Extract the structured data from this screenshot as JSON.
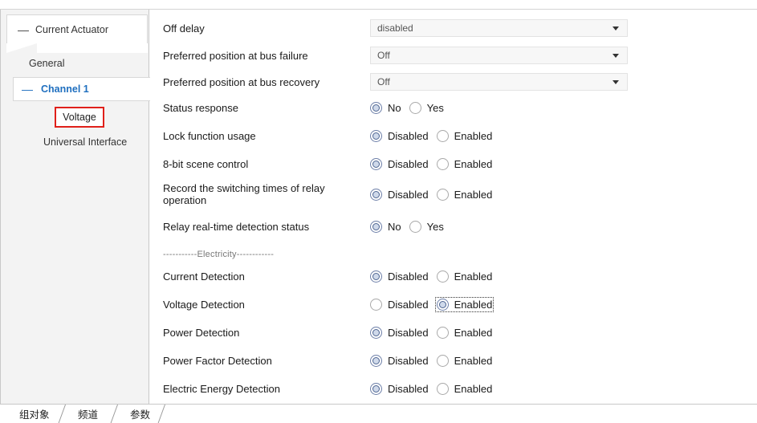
{
  "sidebar": {
    "root": "Current Actuator",
    "general": "General",
    "channel": "Channel 1",
    "voltage": "Voltage",
    "universal": "Universal Interface"
  },
  "params": {
    "off_delay": {
      "label": "Off delay",
      "value": "disabled"
    },
    "bus_failure": {
      "label": "Preferred position at bus failure",
      "value": "Off"
    },
    "bus_recovery": {
      "label": "Preferred position at bus recovery",
      "value": "Off"
    },
    "status_response": {
      "label": "Status response",
      "opt1": "No",
      "opt2": "Yes",
      "selected": "No"
    },
    "lock_function": {
      "label": "Lock function usage",
      "opt1": "Disabled",
      "opt2": "Enabled",
      "selected": "Disabled"
    },
    "scene_control": {
      "label": "8-bit scene control",
      "opt1": "Disabled",
      "opt2": "Enabled",
      "selected": "Disabled"
    },
    "record_switching": {
      "label": "Record the switching times of relay operation",
      "opt1": "Disabled",
      "opt2": "Enabled",
      "selected": "Disabled"
    },
    "relay_detection": {
      "label": "Relay real-time detection status",
      "opt1": "No",
      "opt2": "Yes",
      "selected": "No"
    },
    "separator": "-----------Electricity------------",
    "current_detection": {
      "label": "Current Detection",
      "opt1": "Disabled",
      "opt2": "Enabled",
      "selected": "Disabled"
    },
    "voltage_detection": {
      "label": "Voltage Detection",
      "opt1": "Disabled",
      "opt2": "Enabled",
      "selected": "Enabled"
    },
    "power_detection": {
      "label": "Power Detection",
      "opt1": "Disabled",
      "opt2": "Enabled",
      "selected": "Disabled"
    },
    "power_factor_detection": {
      "label": "Power Factor Detection",
      "opt1": "Disabled",
      "opt2": "Enabled",
      "selected": "Disabled"
    },
    "energy_detection": {
      "label": "Electric Energy Detection",
      "opt1": "Disabled",
      "opt2": "Enabled",
      "selected": "Disabled"
    }
  },
  "tabs": {
    "group_objects": "组对象",
    "channels": "频道",
    "parameters": "参数"
  }
}
